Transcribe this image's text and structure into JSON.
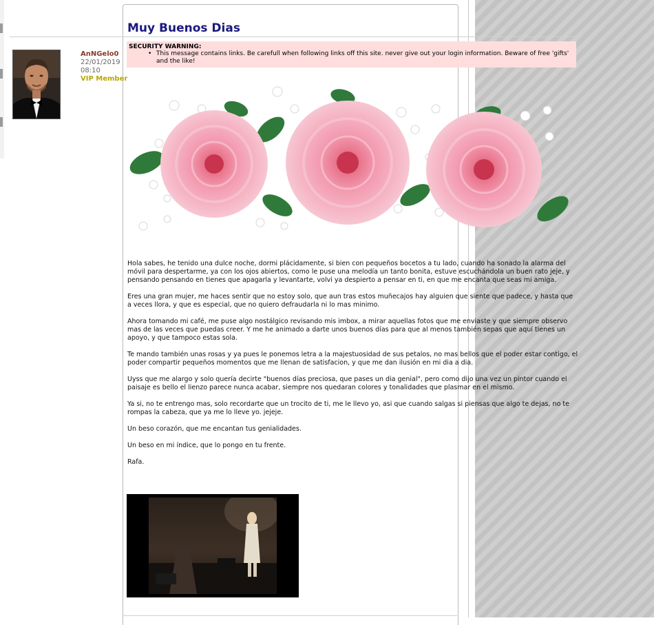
{
  "post": {
    "title": "Muy Buenos Dias",
    "author": {
      "name": "AnNGelo0",
      "date": "22/01/2019",
      "time": "08:10",
      "level": "VIP Member"
    },
    "security_warning": {
      "title": "SECURITY WARNING:",
      "message": "This message contains links. Be carefull when following links off this site. never give out your login information. Beware of free 'gifts' and the like!"
    },
    "paragraphs": [
      "Hola sabes, he tenido una dulce noche, dormi plácidamente, si bien con pequeños bocetos a tu lado, cuando ha sonado la alarma del móvil para despertarme, ya con los ojos abiertos, como le puse una melodía un tanto bonita, estuve escuchándola un buen rato jeje, y pensando pensando en tienes que apagarla y levantarte, volvi ya despierto a pensar en ti, en que me encanta que seas mi amiga.",
      "Eres una gran mujer, me haces sentir que no estoy solo, que aun tras estos muñecajos hay alguien que siente que padece, y hasta que a veces llora, y que es especial, que no quiero defraudarla ni lo mas minimo.",
      "Ahora tomando mi café, me puse algo nostálgico revisando mis imbox, a mirar aquellas fotos que me enviaste y que siempre observo mas de las veces que puedas creer. Y me he animado a darte unos buenos días para que al menos también sepas que aquí tienes un apoyo, y que tampoco estas sola.",
      "Te mando también unas rosas y ya pues le ponemos letra a la majestuosidad de sus petalos, no mas bellos que el poder estar contigo, el poder compartir pequeños momentos que me llenan de satisfacion, y que me dan ilusión en mi dia a dia.",
      "Uyss que me alargo y solo quería decirte \"buenos días preciosa, que pases un dia genial\", pero como dijo una vez un pintor cuando el paisaje es bello el lienzo parece nunca acabar, siempre nos quedaran colores y tonalidades que plasmar en el mismo.",
      "Ya si, no te entrengo mas, solo recordarte que un trocito de ti, me le llevo yo, asi que cuando salgas si piensas que algo te dejas, no te rompas la cabeza, que ya me lo lleve yo. jejeje.",
      "Un beso corazón, que me encantan tus genialidades.",
      "Un beso en mi índice, que lo pongo en tu frente.",
      "Rafa."
    ]
  },
  "colors": {
    "title": "#1a1a7e",
    "username": "#8b3a2a",
    "level": "#b5a800",
    "warning_bg": "#ffdddd"
  }
}
